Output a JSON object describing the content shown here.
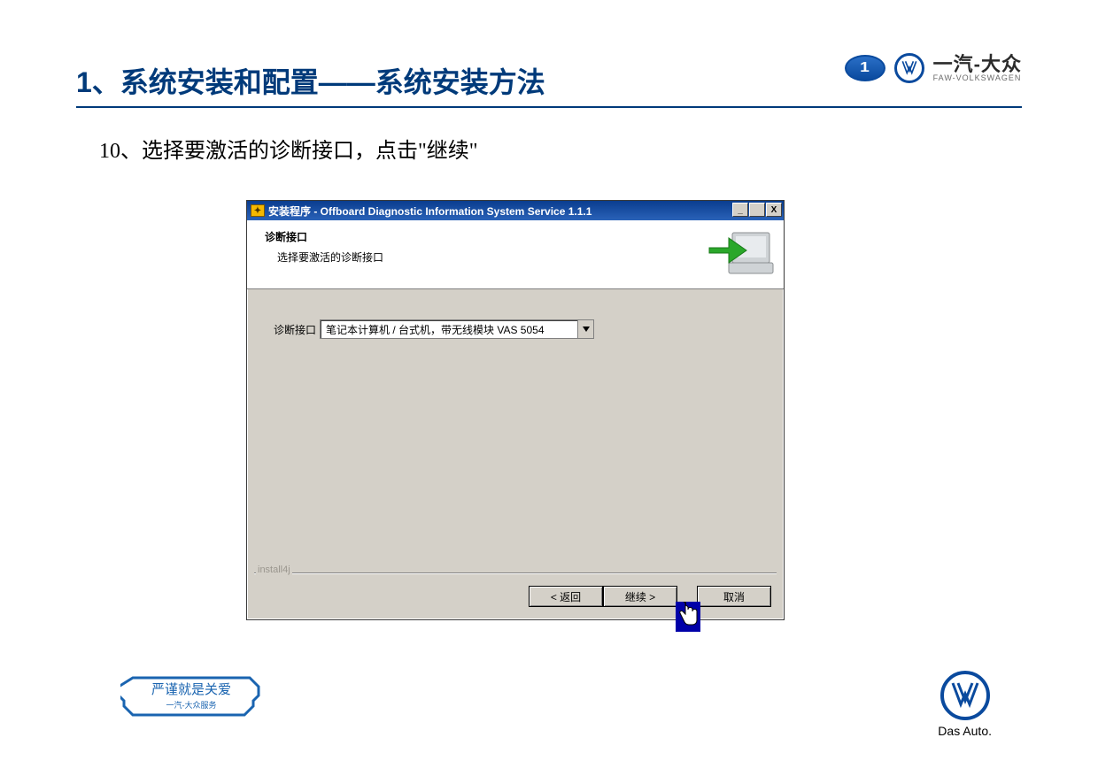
{
  "slide": {
    "title": "1、系统安装和配置——系统安装方法",
    "step": "10、选择要激活的诊断接口，点击\"继续\""
  },
  "brand": {
    "faw_num": "1",
    "cn": "一汽-大众",
    "en": "FAW-VOLKSWAGEN",
    "das_auto": "Das Auto."
  },
  "window": {
    "title": "安装程序 - Offboard Diagnostic Information System Service 1.1.1",
    "minimize_glyph": "_",
    "maximize_glyph": "□",
    "close_glyph": "X",
    "header_title": "诊断接口",
    "header_sub": "选择要激活的诊断接口",
    "combo_label": "诊断接口",
    "combo_value": "笔记本计算机 / 台式机，带无线模块 VAS 5054",
    "install4j": "install4j",
    "btn_back": "< 返回",
    "btn_next": "继续 >",
    "btn_cancel": "取消"
  },
  "badge": {
    "line1": "严谨就是关爱",
    "line2": "一汽-大众服务"
  }
}
